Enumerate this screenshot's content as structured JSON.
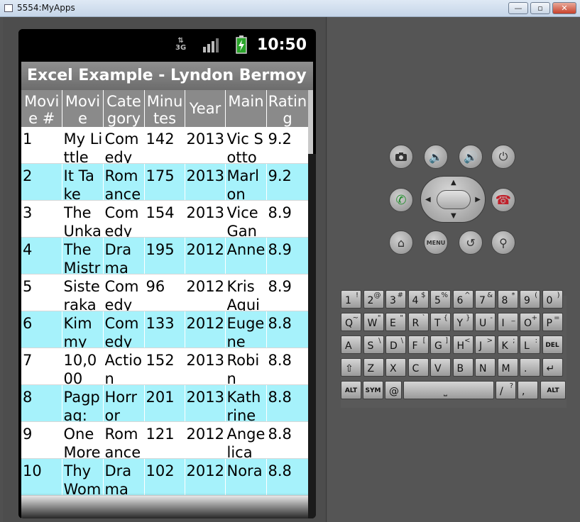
{
  "window": {
    "title": "5554:MyApps",
    "minimize": "—",
    "maximize": "▫",
    "close": "✕"
  },
  "status_bar": {
    "network": "3G",
    "time": "10:50"
  },
  "app": {
    "title": "Excel Example - Lyndon Bermoy"
  },
  "table": {
    "headers": [
      "Movie #",
      "Movie",
      "Category",
      "Minutes",
      "Year",
      "Main",
      "Rating"
    ],
    "header_visible": [
      "Movi e #",
      "Movi e",
      "Cate gory",
      "Minu tes",
      "Year",
      "Main",
      "Ratin g"
    ],
    "rows": [
      [
        "1",
        "My Little",
        "Comedy",
        "142",
        "2013",
        "Vic Sotto",
        "9.2"
      ],
      [
        "2",
        "It Take",
        "Romance",
        "175",
        "2013",
        "Marl on",
        "9.2"
      ],
      [
        "3",
        "The Unka",
        "Comedy",
        "154",
        "2013",
        "Vice Gand",
        "8.9"
      ],
      [
        "4",
        "The Mistr",
        "Drama",
        "195",
        "2012",
        "Anne",
        "8.9"
      ],
      [
        "5",
        "Siste raka",
        "Comedy",
        "96",
        "2012",
        "Kris Aqui",
        "8.9"
      ],
      [
        "6",
        "Kim my",
        "Comedy",
        "133",
        "2012",
        "Euge ne",
        "8.8"
      ],
      [
        "7",
        "10,0 00",
        "Action",
        "152",
        "2013",
        "Robi n",
        "8.8"
      ],
      [
        "8",
        "Pagp ag:",
        "Horror",
        "201",
        "2013",
        "Kath rine",
        "8.8"
      ],
      [
        "9",
        "One More",
        "Romance",
        "121",
        "2012",
        "Ange lica",
        "8.8"
      ],
      [
        "10",
        "Thy Womb",
        "Drama",
        "102",
        "2012",
        "Nora",
        "8.8"
      ]
    ]
  },
  "controls": {
    "camera_icon": "camera-icon",
    "volume_down_icon": "volume-down-icon",
    "volume_up_icon": "volume-up-icon",
    "power_icon": "power-icon",
    "call_icon": "call-icon",
    "end_call_icon": "end-call-icon",
    "home_icon": "home-icon",
    "menu_label": "MENU",
    "back_icon": "back-icon",
    "search_icon": "search-icon"
  },
  "keyboard": {
    "rows": [
      [
        [
          "1",
          "!"
        ],
        [
          "2",
          "@"
        ],
        [
          "3",
          "#"
        ],
        [
          "4",
          "$"
        ],
        [
          "5",
          "%"
        ],
        [
          "6",
          "^"
        ],
        [
          "7",
          "&"
        ],
        [
          "8",
          "*"
        ],
        [
          "9",
          "("
        ],
        [
          "0",
          ")"
        ]
      ],
      [
        [
          "Q",
          "~"
        ],
        [
          "W",
          "\""
        ],
        [
          "E",
          "\""
        ],
        [
          "R",
          "`"
        ],
        [
          "T",
          "{"
        ],
        [
          "Y",
          "}"
        ],
        [
          "U",
          "-"
        ],
        [
          "I",
          "_"
        ],
        [
          "O",
          "+"
        ],
        [
          "P",
          "="
        ]
      ],
      [
        [
          "A",
          ""
        ],
        [
          "S",
          "\\"
        ],
        [
          "D",
          "\\"
        ],
        [
          "F",
          "["
        ],
        [
          "G",
          "]"
        ],
        [
          "H",
          "<"
        ],
        [
          "J",
          ">"
        ],
        [
          "K",
          ";"
        ],
        [
          "L",
          ":"
        ],
        [
          "DEL",
          ""
        ]
      ],
      [
        [
          "⇧",
          ""
        ],
        [
          "Z",
          ""
        ],
        [
          "X",
          ""
        ],
        [
          "C",
          ""
        ],
        [
          "V",
          ""
        ],
        [
          "B",
          ""
        ],
        [
          "N",
          ""
        ],
        [
          "M",
          ""
        ],
        [
          ".",
          ""
        ],
        [
          "↵",
          ""
        ]
      ],
      [
        [
          "ALT",
          ""
        ],
        [
          "SYM",
          ""
        ],
        [
          "@",
          ""
        ],
        [
          "",
          ""
        ],
        [
          "/",
          "?"
        ],
        [
          ",",
          ""
        ],
        [
          "ALT",
          ""
        ]
      ]
    ]
  },
  "colors": {
    "row_alt": "#a6f2fb",
    "header_bg": "#8a8a8a",
    "appbar_bg": "#7d7d7d"
  }
}
